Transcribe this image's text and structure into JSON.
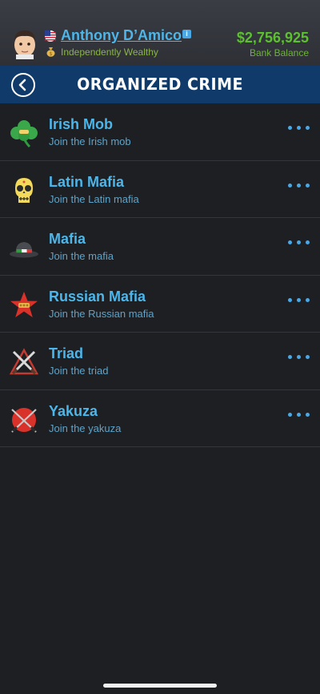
{
  "profile": {
    "name": "Anthony D’Amico",
    "status": "Independently Wealthy",
    "balance": "$2,756,925",
    "balance_label": "Bank Balance"
  },
  "header": {
    "title": "ORGANIZED CRIME"
  },
  "organizations": [
    {
      "title": "Irish Mob",
      "subtitle": "Join the Irish mob",
      "icon": "shamrock-icon"
    },
    {
      "title": "Latin Mafia",
      "subtitle": "Join the Latin mafia",
      "icon": "sugar-skull-icon"
    },
    {
      "title": "Mafia",
      "subtitle": "Join the mafia",
      "icon": "fedora-hat-icon"
    },
    {
      "title": "Russian Mafia",
      "subtitle": "Join the Russian mafia",
      "icon": "red-star-icon"
    },
    {
      "title": "Triad",
      "subtitle": "Join the triad",
      "icon": "crossed-swords-icon"
    },
    {
      "title": "Yakuza",
      "subtitle": "Join the yakuza",
      "icon": "crossed-katanas-icon"
    }
  ],
  "colors": {
    "background": "#1e1f22",
    "header_bar": "#0f3a69",
    "link_blue": "#4cb6ea",
    "money_green": "#5cc12f"
  }
}
